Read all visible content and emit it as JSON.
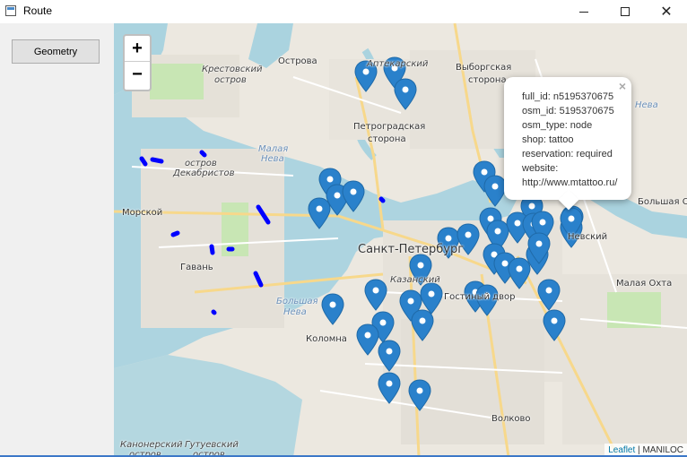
{
  "window": {
    "title": "Route"
  },
  "toolbar": {
    "geometry_label": "Geometry"
  },
  "map": {
    "zoom_in": "+",
    "zoom_out": "−",
    "labels": {
      "ostrova": "Острова",
      "krestovsky": "Крестовский",
      "ostrov": "остров",
      "aptekarsky": "Аптекарский",
      "vyborgskaya": "Выборгская",
      "storona": "сторона",
      "petrogradskaya": "Петроградская",
      "storona2": "сторона",
      "malaya_neva": "Малая",
      "neva": "Нева",
      "ostrov_dekabristov_1": "остров",
      "ostrov_dekabristov_2": "Декабристов",
      "morskoy": "Морской",
      "gavan": "Гавань",
      "spb": "Санкт-Петербург",
      "kazansky": "Казанский",
      "bolshaya_neva_1": "Большая",
      "bolshaya_neva_2": "Нева",
      "kolomna": "Коломна",
      "volkovo": "Волково",
      "malaya_okhta": "Малая Охта",
      "bolshaya_o": "Большая О",
      "kanonersky_1": "Канонерский",
      "kanonersky_2": "остров",
      "gutuevsky_1": "Гутуевский",
      "gutuevsky_2": "остров",
      "neva_right": "Нева",
      "dvor": "Гостиный двор",
      "nevsky": "Невский"
    },
    "marker_color": "#2a81cb",
    "route_color": "#0000ff"
  },
  "popup": {
    "close": "×",
    "lines": [
      "full_id: n5195370675",
      "osm_id: 5195370675",
      "osm_type: node",
      "shop: tattoo",
      "reservation: required",
      "website:",
      "http://www.mtattoo.ru/"
    ]
  },
  "attribution": {
    "leaflet": "Leaflet",
    "sep": " | ",
    "provider": "MANILOC"
  }
}
